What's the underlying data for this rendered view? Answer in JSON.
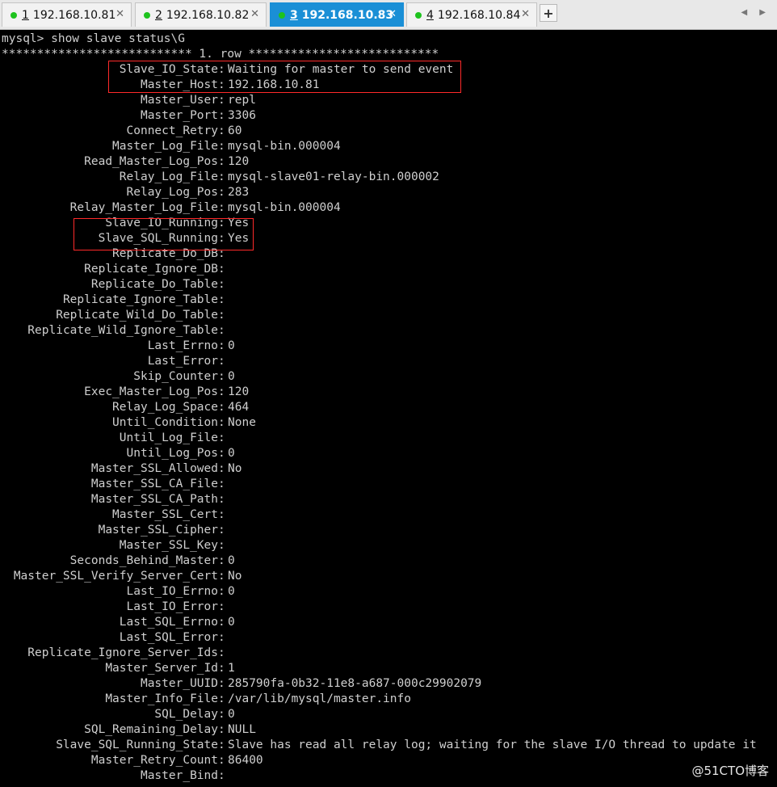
{
  "tabs": [
    {
      "num": "1",
      "label": "192.168.10.81",
      "active": false,
      "status": "connected"
    },
    {
      "num": "2",
      "label": "192.168.10.82",
      "active": false,
      "status": "connected"
    },
    {
      "num": "3",
      "label": "192.168.10.83",
      "active": true,
      "status": "connected"
    },
    {
      "num": "4",
      "label": "192.168.10.84",
      "active": false,
      "status": "connected"
    }
  ],
  "tabbar": {
    "close_glyph": "✕",
    "add_glyph": "+",
    "nav_glyphs": "◀ ▶"
  },
  "colors": {
    "terminal_bg": "#000000",
    "terminal_fg": "#cfcfcf",
    "active_tab": "#1a8fd6",
    "status_dot": "#1ec31e",
    "highlight_border": "#ff2a2a"
  },
  "terminal": {
    "command": "mysql> show slave status\\G",
    "header": "*************************** 1. row ***************************",
    "rows": [
      {
        "key": "Slave_IO_State",
        "value": "Waiting for master to send event"
      },
      {
        "key": "Master_Host",
        "value": "192.168.10.81"
      },
      {
        "key": "Master_User",
        "value": "repl"
      },
      {
        "key": "Master_Port",
        "value": "3306"
      },
      {
        "key": "Connect_Retry",
        "value": "60"
      },
      {
        "key": "Master_Log_File",
        "value": "mysql-bin.000004"
      },
      {
        "key": "Read_Master_Log_Pos",
        "value": "120"
      },
      {
        "key": "Relay_Log_File",
        "value": "mysql-slave01-relay-bin.000002"
      },
      {
        "key": "Relay_Log_Pos",
        "value": "283"
      },
      {
        "key": "Relay_Master_Log_File",
        "value": "mysql-bin.000004"
      },
      {
        "key": "Slave_IO_Running",
        "value": "Yes"
      },
      {
        "key": "Slave_SQL_Running",
        "value": "Yes"
      },
      {
        "key": "Replicate_Do_DB",
        "value": ""
      },
      {
        "key": "Replicate_Ignore_DB",
        "value": ""
      },
      {
        "key": "Replicate_Do_Table",
        "value": ""
      },
      {
        "key": "Replicate_Ignore_Table",
        "value": ""
      },
      {
        "key": "Replicate_Wild_Do_Table",
        "value": ""
      },
      {
        "key": "Replicate_Wild_Ignore_Table",
        "value": ""
      },
      {
        "key": "Last_Errno",
        "value": "0"
      },
      {
        "key": "Last_Error",
        "value": ""
      },
      {
        "key": "Skip_Counter",
        "value": "0"
      },
      {
        "key": "Exec_Master_Log_Pos",
        "value": "120"
      },
      {
        "key": "Relay_Log_Space",
        "value": "464"
      },
      {
        "key": "Until_Condition",
        "value": "None"
      },
      {
        "key": "Until_Log_File",
        "value": ""
      },
      {
        "key": "Until_Log_Pos",
        "value": "0"
      },
      {
        "key": "Master_SSL_Allowed",
        "value": "No"
      },
      {
        "key": "Master_SSL_CA_File",
        "value": ""
      },
      {
        "key": "Master_SSL_CA_Path",
        "value": ""
      },
      {
        "key": "Master_SSL_Cert",
        "value": ""
      },
      {
        "key": "Master_SSL_Cipher",
        "value": ""
      },
      {
        "key": "Master_SSL_Key",
        "value": ""
      },
      {
        "key": "Seconds_Behind_Master",
        "value": "0"
      },
      {
        "key": "Master_SSL_Verify_Server_Cert",
        "value": "No"
      },
      {
        "key": "Last_IO_Errno",
        "value": "0"
      },
      {
        "key": "Last_IO_Error",
        "value": ""
      },
      {
        "key": "Last_SQL_Errno",
        "value": "0"
      },
      {
        "key": "Last_SQL_Error",
        "value": ""
      },
      {
        "key": "Replicate_Ignore_Server_Ids",
        "value": ""
      },
      {
        "key": "Master_Server_Id",
        "value": "1"
      },
      {
        "key": "Master_UUID",
        "value": "285790fa-0b32-11e8-a687-000c29902079"
      },
      {
        "key": "Master_Info_File",
        "value": "/var/lib/mysql/master.info"
      },
      {
        "key": "SQL_Delay",
        "value": "0"
      },
      {
        "key": "SQL_Remaining_Delay",
        "value": "NULL"
      },
      {
        "key": "Slave_SQL_Running_State",
        "value": "Slave has read all relay log; waiting for the slave I/O thread to update it"
      },
      {
        "key": "Master_Retry_Count",
        "value": "86400"
      },
      {
        "key": "Master_Bind",
        "value": ""
      }
    ]
  },
  "watermark": "@51CTO博客"
}
